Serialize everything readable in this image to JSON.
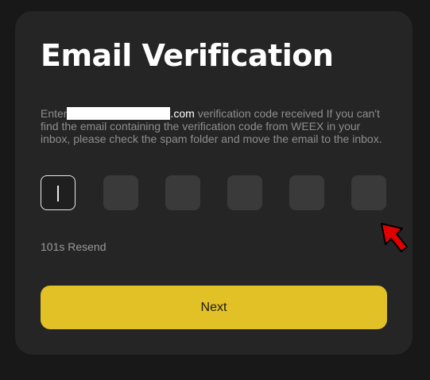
{
  "dialog": {
    "title": "Email Verification",
    "description_prefix": "Enter",
    "email_domain": ".com",
    "description_suffix": " verification code received If you can't find the email containing the verification code from WEEX in your inbox, please check the spam folder and move the email to the inbox.",
    "resend_text": "101s Resend",
    "next_label": "Next"
  },
  "code_inputs": [
    "",
    "",
    "",
    "",
    "",
    ""
  ],
  "colors": {
    "accent": "#e2c126",
    "card_bg": "#252525",
    "page_bg": "#181818",
    "cursor": "#e00000"
  }
}
